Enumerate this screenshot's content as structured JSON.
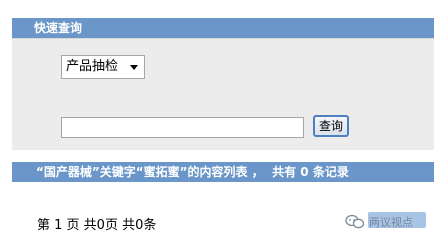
{
  "quick_search": {
    "title": "快速查询",
    "category_select": {
      "selected": "产品抽检"
    },
    "keyword_input": {
      "value": "",
      "placeholder": ""
    },
    "search_button_label": "查询"
  },
  "result_summary": {
    "part1": "“国产器械”关键字“蜜拓蜜”的内容列表",
    "part2": " ，  共有 ",
    "count": "0",
    "part3": " 条记录"
  },
  "pagination": {
    "page_label": "第 1 页",
    "total_pages": " 共0页",
    "total_items": " 共0条"
  },
  "watermark": {
    "text": "两议视点"
  },
  "colors": {
    "header_bg": "#6b96c9",
    "panel_bg": "#ececec",
    "button_border": "#4f7fc0"
  }
}
